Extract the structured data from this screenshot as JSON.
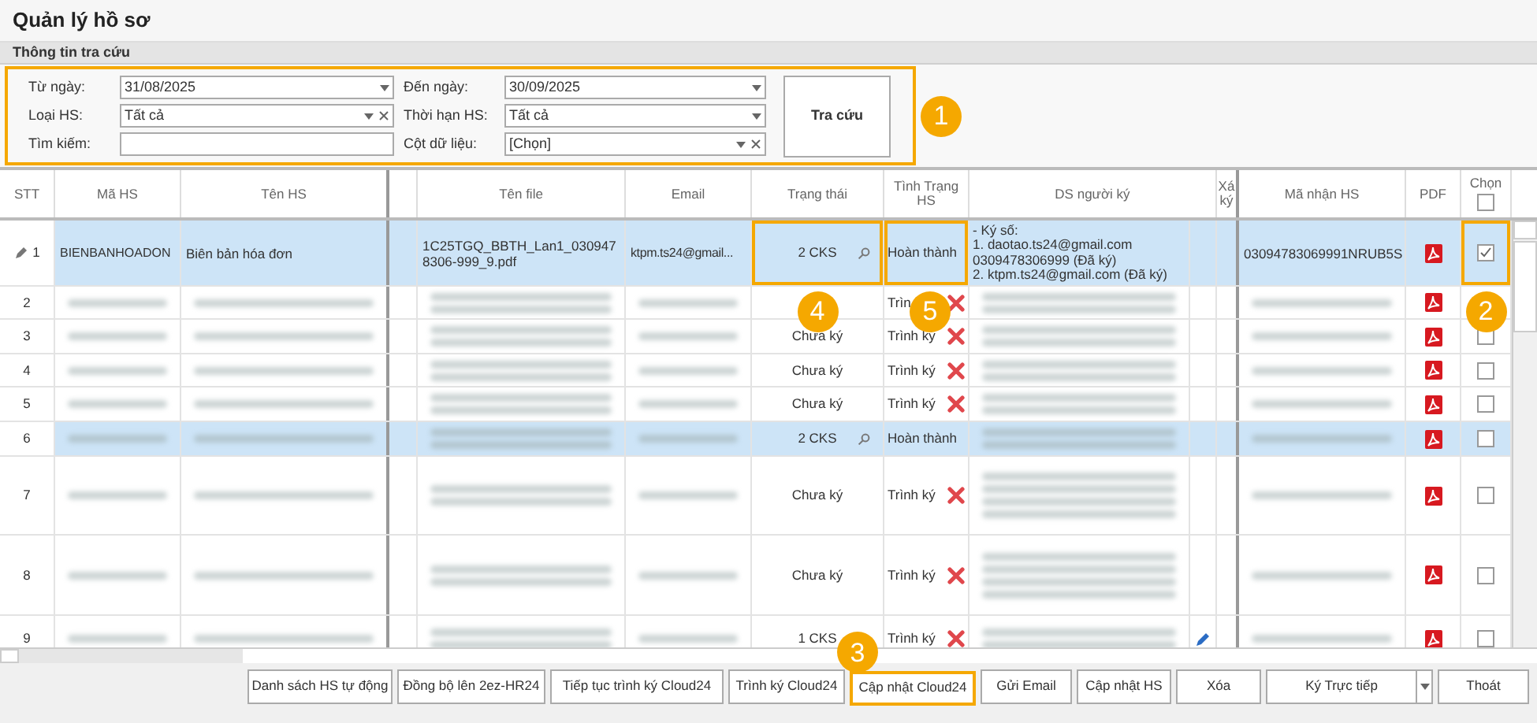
{
  "title": "Quản lý hồ sơ",
  "section": "Thông tin tra cứu",
  "filter": {
    "highlighted": true,
    "badge": "1",
    "search_button": "Tra cứu",
    "fields": [
      {
        "label": "Từ ngày:",
        "kind": "combo",
        "value": "31/08/2025",
        "clearable": false
      },
      {
        "label": "Đến ngày:",
        "kind": "combo",
        "value": "30/09/2025",
        "clearable": false
      },
      {
        "label": "Loại HS:",
        "kind": "combo",
        "value": "Tất cả",
        "clearable": true
      },
      {
        "label": "Thời hạn HS:",
        "kind": "combo",
        "value": "Tất cả",
        "clearable": false
      },
      {
        "label": "Tìm kiếm:",
        "kind": "text"
      },
      {
        "label": "Cột dữ liệu:",
        "kind": "combo",
        "value": "[Chọn]",
        "clearable": true
      }
    ]
  },
  "table": {
    "columns": [
      {
        "label": "STT"
      },
      {
        "label": "Mã HS"
      },
      {
        "label": "Tên HS"
      },
      {},
      {
        "label": "Tên file"
      },
      {
        "label": "Email"
      },
      {
        "label": "Trạng thái"
      },
      {
        "label": "Tình Trạng HS"
      },
      {
        "label": "DS người ký"
      },
      {
        "label": "Xá ký"
      },
      {
        "label": "Mã nhận HS"
      },
      {
        "label": "PDF"
      },
      {
        "label": "Chọn",
        "checked": false
      }
    ],
    "rows": [
      {
        "stt": "1",
        "editing": true,
        "selected": true,
        "blurred": false,
        "ma_hs": "BIENBANHOADON",
        "ten_hs": "Biên bản hóa đơn",
        "ten_file": "1C25TGQ_BBTH_Lan1_0309478306-999_9.pdf",
        "email": "ktpm.ts24@gmail...",
        "trang_thai": "2 CKS",
        "lookup": true,
        "tinh_trang": "Hoàn thành",
        "deletable": false,
        "signers": [
          "- Ký số:",
          "1. daotao.ts24@gmail.com",
          "0309478306999 (Đã ký)",
          "2. ktpm.ts24@gmail.com (Đã ký)"
        ],
        "sign_edit": false,
        "ma_nhan_hs": "03094783069991NRUB5S",
        "chon": true,
        "status_badge": "4",
        "condition_badge": "5",
        "select_badge": "2"
      },
      {
        "stt": "2",
        "editing": false,
        "selected": false,
        "blurred": true,
        "tinh_trang": "Trìn",
        "deletable": true,
        "sign_edit": false
      },
      {
        "stt": "3",
        "editing": false,
        "selected": false,
        "blurred": true,
        "trang_thai": "Chưa ký",
        "lookup": false,
        "tinh_trang": "Trình ký",
        "deletable": true,
        "sign_edit": false,
        "chon": false
      },
      {
        "stt": "4",
        "editing": false,
        "selected": false,
        "blurred": true,
        "trang_thai": "Chưa ký",
        "lookup": false,
        "tinh_trang": "Trình ký",
        "deletable": true,
        "sign_edit": false,
        "chon": false
      },
      {
        "stt": "5",
        "editing": false,
        "selected": false,
        "blurred": true,
        "trang_thai": "Chưa ký",
        "lookup": false,
        "tinh_trang": "Trình ký",
        "deletable": true,
        "sign_edit": false,
        "chon": false
      },
      {
        "stt": "6",
        "editing": false,
        "selected": true,
        "blurred": true,
        "trang_thai": "2 CKS",
        "lookup": true,
        "tinh_trang": "Hoàn thành",
        "deletable": false,
        "sign_edit": false,
        "chon": false
      },
      {
        "stt": "7",
        "editing": false,
        "selected": false,
        "blurred": true,
        "trang_thai": "Chưa ký",
        "lookup": false,
        "tinh_trang": "Trình ký",
        "deletable": true,
        "sign_edit": false,
        "chon": false
      },
      {
        "stt": "8",
        "editing": false,
        "selected": false,
        "blurred": true,
        "trang_thai": "Chưa ký",
        "lookup": false,
        "tinh_trang": "Trình ký",
        "deletable": true,
        "sign_edit": false,
        "chon": false
      },
      {
        "stt": "9",
        "editing": false,
        "selected": false,
        "blurred": true,
        "trang_thai": "1 CKS",
        "lookup": false,
        "tinh_trang": "Trình ký",
        "deletable": true,
        "sign_edit": true,
        "chon": false
      }
    ]
  },
  "buttons": [
    {
      "label": "Danh sách HS tự động",
      "kind": "plain",
      "highlighted": false
    },
    {
      "label": "Đồng bộ lên 2ez-HR24",
      "kind": "plain",
      "highlighted": false
    },
    {
      "label": "Tiếp tục trình ký Cloud24",
      "kind": "plain",
      "highlighted": false
    },
    {
      "label": "Trình ký Cloud24",
      "kind": "plain",
      "highlighted": false
    },
    {
      "label": "Cập nhật Cloud24",
      "kind": "plain",
      "highlighted": true,
      "badge": "3"
    },
    {
      "label": "Gửi Email",
      "kind": "plain",
      "highlighted": false
    },
    {
      "label": "Cập nhật HS",
      "kind": "plain",
      "highlighted": false
    },
    {
      "label": "Xóa",
      "kind": "plain",
      "highlighted": false
    },
    {
      "label": "Ký Trực tiếp",
      "kind": "split",
      "highlighted": false
    },
    {
      "label": "Thoát",
      "kind": "plain",
      "highlighted": false
    }
  ]
}
